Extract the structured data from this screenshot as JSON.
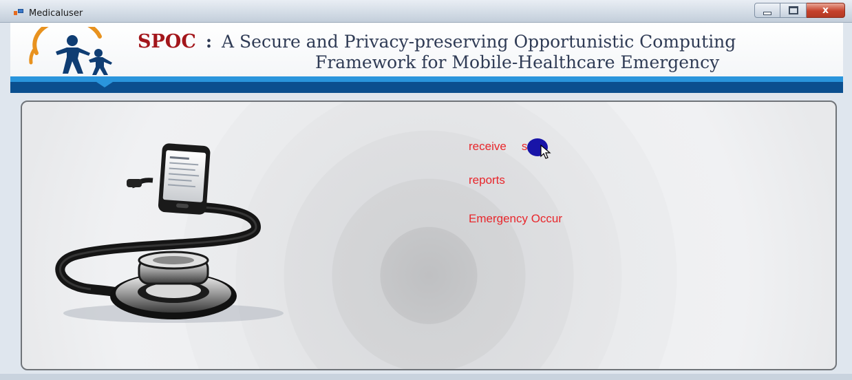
{
  "window": {
    "title": "Medicaluser",
    "minimize_label": "",
    "maximize_label": "",
    "close_label": "x"
  },
  "header": {
    "brand": "SPOC",
    "separator": ":",
    "title_line1": "A Secure and Privacy-preserving Opportunistic Computing",
    "title_line2": "Framework for Mobile-Healthcare Emergency",
    "logo_icon": "family-logo-icon",
    "colors": {
      "brand": "#a3161b",
      "title": "#2f3b55",
      "band_light": "#2a95dc",
      "band_dark": "#0b4f8f"
    }
  },
  "menu": {
    "items": [
      {
        "label": "receivedfiles",
        "visible_label": "receive",
        "visible_suffix": "s"
      },
      {
        "label": "reports"
      },
      {
        "label": "Emergency Occur"
      }
    ],
    "link_color": "#e8262b"
  },
  "illustration": {
    "icon": "phone-stethoscope-icon"
  }
}
